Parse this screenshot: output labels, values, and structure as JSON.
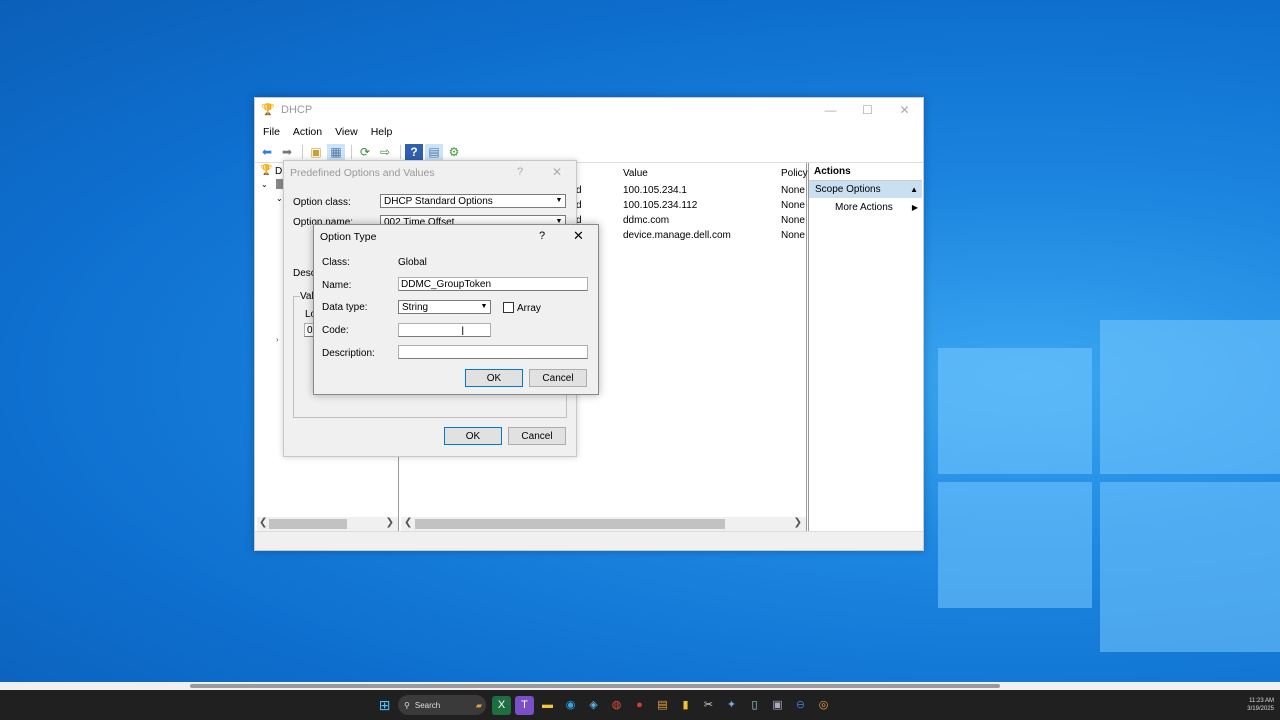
{
  "dhcp_window": {
    "title": "DHCP",
    "menu": [
      "File",
      "Action",
      "View",
      "Help"
    ],
    "tree_root": "DH",
    "columns": {
      "value": "Value",
      "policy": "Policy"
    },
    "rows": [
      {
        "name_tail": "d",
        "value": "100.105.234.1",
        "policy": "None"
      },
      {
        "name_tail": "d",
        "value": "100.105.234.112",
        "policy": "None"
      },
      {
        "name_tail": "d",
        "value": "ddmc.com",
        "policy": "None"
      },
      {
        "name_tail": "d",
        "value": "device.manage.dell.com",
        "policy": "None"
      }
    ],
    "actions": {
      "header": "Actions",
      "selected": "Scope Options",
      "item": "More Actions"
    }
  },
  "predefined_dialog": {
    "title": "Predefined Options and Values",
    "option_class_label": "Option class:",
    "option_class_value": "DHCP Standard Options",
    "option_name_label": "Option name:",
    "option_name_value": "002 Time Offset",
    "description_label": "Descr",
    "value_group_label": "Valu",
    "long_label": "Lo",
    "value_cell": "0x",
    "ok": "OK",
    "cancel": "Cancel"
  },
  "option_type_dialog": {
    "title": "Option Type",
    "help": "?",
    "close": "✕",
    "class_label": "Class:",
    "class_value": "Global",
    "name_label": "Name:",
    "name_value": "DDMC_GroupToken",
    "datatype_label": "Data type:",
    "datatype_value": "String",
    "array_label": "Array",
    "code_label": "Code:",
    "code_value": "",
    "description_label": "Description:",
    "description_value": "",
    "ok": "OK",
    "cancel": "Cancel"
  },
  "taskbar": {
    "search_label": "Search",
    "time": "11:23 AM",
    "date": "3/19/2025"
  }
}
